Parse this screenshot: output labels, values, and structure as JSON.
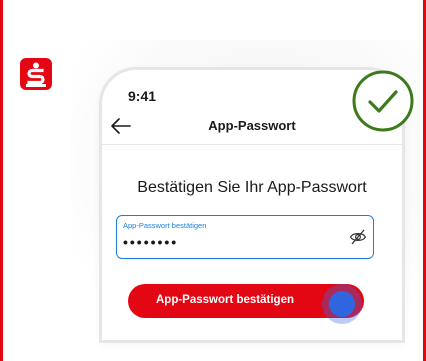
{
  "colors": {
    "brand_red": "#e30613",
    "accent_blue": "#1b7fd6",
    "success_green": "#3d7a1e",
    "tap_blue": "#2f66e0"
  },
  "brand": {
    "logo_icon": "sparkasse-s-logo-icon"
  },
  "phone": {
    "status_time": "9:41",
    "nav": {
      "back_icon": "arrow-left-icon",
      "title": "App-Passwort"
    },
    "heading": "Bestätigen Sie Ihr App-Passwort",
    "password_field": {
      "label": "App-Passwort bestätigen",
      "value": "••••••••",
      "visibility_icon": "eye-off-icon"
    },
    "confirm_button": {
      "label": "App-Passwort bestätigen"
    }
  },
  "overlay": {
    "success_icon": "checkmark-circle-icon",
    "tap_indicator": "tap-indicator"
  }
}
